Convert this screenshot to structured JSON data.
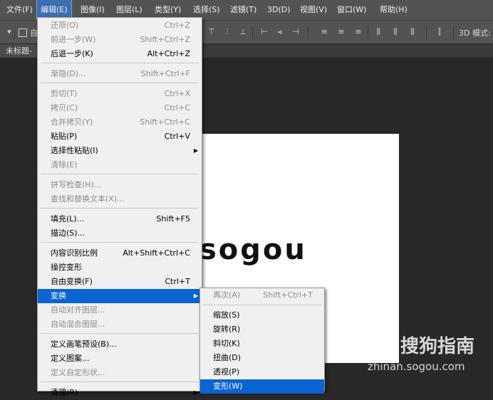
{
  "menubar": [
    {
      "label": "文件(F)",
      "active": false
    },
    {
      "label": "编辑(E)",
      "active": true
    },
    {
      "label": "图像(I)",
      "active": false
    },
    {
      "label": "图层(L)",
      "active": false
    },
    {
      "label": "类型(Y)",
      "active": false
    },
    {
      "label": "选择(S)",
      "active": false
    },
    {
      "label": "滤镜(T)",
      "active": false
    },
    {
      "label": "3D(D)",
      "active": false
    },
    {
      "label": "视图(V)",
      "active": false
    },
    {
      "label": "窗口(W)",
      "active": false
    },
    {
      "label": "帮助(H)",
      "active": false
    }
  ],
  "options_bar": {
    "checkbox_label": "自",
    "mode_label": "3D 模式:"
  },
  "document_tab": {
    "title": "未标题-"
  },
  "canvas": {
    "text": "sogou"
  },
  "edit_menu": {
    "items": [
      {
        "label": "还原(O)",
        "shortcut": "Ctrl+Z",
        "disabled": true
      },
      {
        "label": "前进一步(W)",
        "shortcut": "Shift+Ctrl+Z",
        "disabled": true
      },
      {
        "label": "后退一步(K)",
        "shortcut": "Alt+Ctrl+Z",
        "disabled": false
      },
      {
        "label": "渐隐(D)...",
        "shortcut": "Shift+Ctrl+F",
        "disabled": true
      },
      {
        "label": "剪切(T)",
        "shortcut": "Ctrl+X",
        "disabled": true
      },
      {
        "label": "拷贝(C)",
        "shortcut": "Ctrl+C",
        "disabled": true
      },
      {
        "label": "合并拷贝(Y)",
        "shortcut": "Shift+Ctrl+C",
        "disabled": true
      },
      {
        "label": "粘贴(P)",
        "shortcut": "Ctrl+V",
        "disabled": false
      },
      {
        "label": "选择性粘贴(I)",
        "shortcut": "",
        "disabled": false,
        "submenu": true
      },
      {
        "label": "清除(E)",
        "shortcut": "",
        "disabled": true
      },
      {
        "label": "拼写检查(H)...",
        "shortcut": "",
        "disabled": true
      },
      {
        "label": "查找和替换文本(X)...",
        "shortcut": "",
        "disabled": true
      },
      {
        "label": "填充(L)...",
        "shortcut": "Shift+F5",
        "disabled": false
      },
      {
        "label": "描边(S)...",
        "shortcut": "",
        "disabled": false
      },
      {
        "label": "内容识别比例",
        "shortcut": "Alt+Shift+Ctrl+C",
        "disabled": false
      },
      {
        "label": "操控变形",
        "shortcut": "",
        "disabled": false
      },
      {
        "label": "自由变换(F)",
        "shortcut": "Ctrl+T",
        "disabled": false
      },
      {
        "label": "变换",
        "shortcut": "",
        "disabled": false,
        "submenu": true,
        "selected": true
      },
      {
        "label": "自动对齐图层...",
        "shortcut": "",
        "disabled": true
      },
      {
        "label": "自动混合图层...",
        "shortcut": "",
        "disabled": true
      },
      {
        "label": "定义画笔预设(B)...",
        "shortcut": "",
        "disabled": false
      },
      {
        "label": "定义图案...",
        "shortcut": "",
        "disabled": false
      },
      {
        "label": "定义自定形状...",
        "shortcut": "",
        "disabled": true
      },
      {
        "label": "清理(R)",
        "shortcut": "",
        "disabled": false,
        "submenu": true
      }
    ]
  },
  "transform_submenu": {
    "items": [
      {
        "label": "再次(A)",
        "shortcut": "Shift+Ctrl+T",
        "disabled": true
      },
      {
        "label": "缩放(S)",
        "shortcut": "",
        "disabled": false
      },
      {
        "label": "旋转(R)",
        "shortcut": "",
        "disabled": false
      },
      {
        "label": "斜切(K)",
        "shortcut": "",
        "disabled": false
      },
      {
        "label": "扭曲(D)",
        "shortcut": "",
        "disabled": false
      },
      {
        "label": "透视(P)",
        "shortcut": "",
        "disabled": false
      },
      {
        "label": "变形(W)",
        "shortcut": "",
        "disabled": false,
        "selected": true
      }
    ]
  },
  "watermark": {
    "title": "搜狗指南",
    "url": "zhinan.sogou.com"
  }
}
